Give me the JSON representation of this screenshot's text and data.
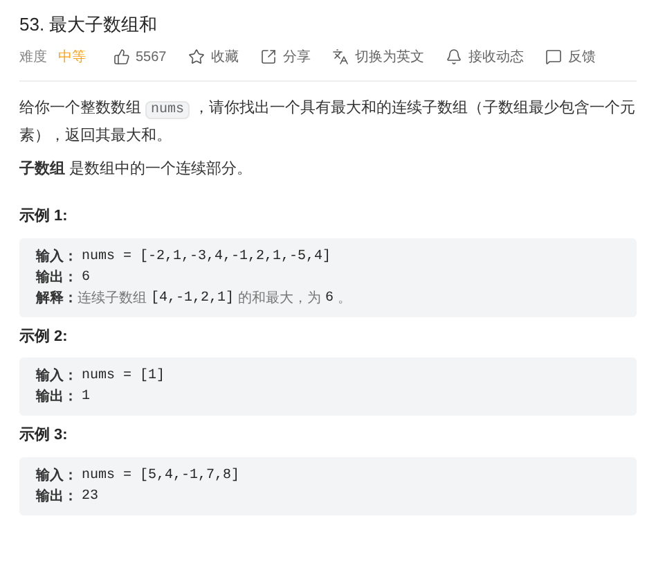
{
  "title": "53. 最大子数组和",
  "meta": {
    "difficulty_label": "难度",
    "difficulty": "中等",
    "actions": [
      {
        "kind": "like",
        "label": "5567"
      },
      {
        "kind": "star",
        "label": "收藏"
      },
      {
        "kind": "share",
        "label": "分享"
      },
      {
        "kind": "translate",
        "label": "切换为英文"
      },
      {
        "kind": "bell",
        "label": "接收动态"
      },
      {
        "kind": "feedback",
        "label": "反馈"
      }
    ]
  },
  "description": [
    {
      "kind": "text",
      "text": "给你一个整数数组"
    },
    {
      "kind": "code",
      "text": "nums"
    },
    {
      "kind": "text",
      "text": "，请你找出一个具有最大和的连续子数组（子数组最少包含一个元素），返回其最大和。"
    }
  ],
  "definition": "**子数组** 是数组中的一个连续部分。",
  "examples": [
    {
      "heading": "示例 1:",
      "lines": [
        {
          "label": "输入：",
          "parts": [
            {
              "kind": "code",
              "text": "nums = [-2,1,-3,4,-1,2,1,-5,4]"
            }
          ]
        },
        {
          "label": "输出：",
          "parts": [
            {
              "kind": "code",
              "text": "6"
            }
          ]
        },
        {
          "label": "解释：",
          "parts": [
            {
              "kind": "text",
              "text": "连续子数组"
            },
            {
              "kind": "code",
              "text": "[4,-1,2,1]"
            },
            {
              "kind": "text",
              "text": "的和最大，为"
            },
            {
              "kind": "code",
              "text": "6"
            },
            {
              "kind": "text",
              "text": "。"
            }
          ]
        }
      ]
    },
    {
      "heading": "示例 2:",
      "lines": [
        {
          "label": "输入：",
          "parts": [
            {
              "kind": "code",
              "text": "nums = [1]"
            }
          ]
        },
        {
          "label": "输出：",
          "parts": [
            {
              "kind": "code",
              "text": "1"
            }
          ]
        }
      ]
    },
    {
      "heading": "示例 3:",
      "lines": [
        {
          "label": "输入：",
          "parts": [
            {
              "kind": "code",
              "text": "nums = [5,4,-1,7,8]"
            }
          ]
        },
        {
          "label": "输出：",
          "parts": [
            {
              "kind": "code",
              "text": "23"
            }
          ]
        }
      ]
    }
  ]
}
